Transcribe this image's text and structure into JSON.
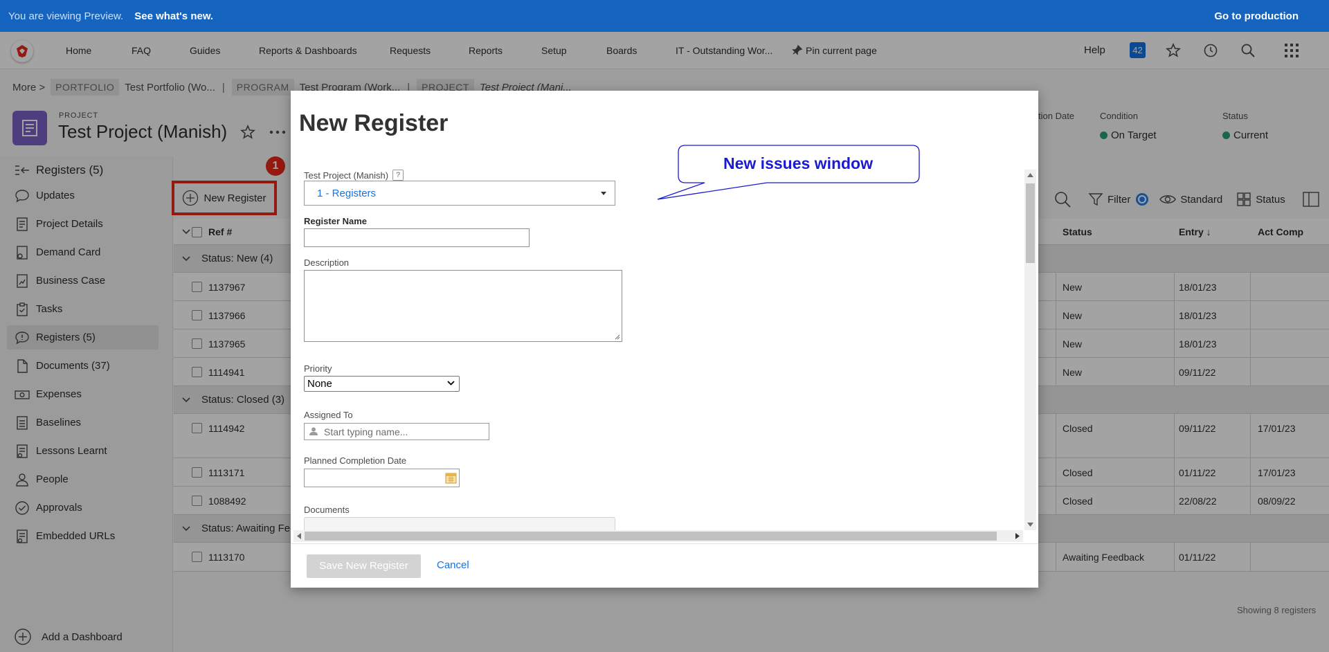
{
  "banner": {
    "text": "You are viewing Preview.",
    "link": "See what's new.",
    "production": "Go to production"
  },
  "nav": {
    "items": [
      "Home",
      "FAQ",
      "Guides",
      "Reports & Dashboards",
      "Requests",
      "Reports",
      "Setup",
      "Boards",
      "IT - Outstanding Wor...",
      "Pin current page"
    ],
    "help": "Help",
    "badge": "42"
  },
  "breadcrumb": {
    "more": "More >",
    "portfolio_tag": "PORTFOLIO",
    "portfolio": "Test Portfolio (Wo...",
    "program_tag": "PROGRAM",
    "program": "Test Program (Work...",
    "project_tag": "PROJECT",
    "project": "Test Project (Mani..."
  },
  "project": {
    "type": "PROJECT",
    "title": "Test Project (Manish)",
    "date_label": "tion Date",
    "condition_label": "Condition",
    "condition": "On Target",
    "status_label": "Status",
    "status": "Current",
    "status_color": "#2d9d78"
  },
  "sidebar": {
    "header": "Registers (5)",
    "items": [
      {
        "label": "Updates",
        "icon": "speech-bubble-icon"
      },
      {
        "label": "Project Details",
        "icon": "document-icon"
      },
      {
        "label": "Demand Card",
        "icon": "demand-card-icon"
      },
      {
        "label": "Business Case",
        "icon": "business-case-icon"
      },
      {
        "label": "Tasks",
        "icon": "clipboard-icon"
      },
      {
        "label": "Registers (5)",
        "icon": "alert-bubble-icon"
      },
      {
        "label": "Documents (37)",
        "icon": "file-icon"
      },
      {
        "label": "Expenses",
        "icon": "money-icon"
      },
      {
        "label": "Baselines",
        "icon": "baseline-icon"
      },
      {
        "label": "Lessons Learnt",
        "icon": "lessons-icon"
      },
      {
        "label": "People",
        "icon": "person-icon"
      },
      {
        "label": "Approvals",
        "icon": "check-circle-icon"
      },
      {
        "label": "Embedded URLs",
        "icon": "link-doc-icon"
      }
    ],
    "add_dashboard": "Add a Dashboard"
  },
  "toolbar": {
    "new_register": "New Register",
    "step_number": "1",
    "filter": "Filter",
    "standard": "Standard",
    "status": "Status"
  },
  "table": {
    "headers": {
      "ref": "Ref #",
      "status": "Status",
      "entry": "Entry ↓",
      "act_comp": "Act Comp"
    },
    "groups": [
      {
        "label": "Status: New (4)",
        "rows": [
          {
            "ref": "1137967",
            "status": "New",
            "entry": "18/01/23",
            "act": ""
          },
          {
            "ref": "1137966",
            "status": "New",
            "entry": "18/01/23",
            "act": ""
          },
          {
            "ref": "1137965",
            "status": "New",
            "entry": "18/01/23",
            "act": ""
          },
          {
            "ref": "1114941",
            "status": "New",
            "entry": "09/11/22",
            "act": ""
          }
        ]
      },
      {
        "label": "Status: Closed (3)",
        "rows": [
          {
            "ref": "1114942",
            "status": "Closed",
            "entry": "09/11/22",
            "act": "17/01/23"
          },
          {
            "ref": "1113171",
            "status": "Closed",
            "entry": "01/11/22",
            "act": "17/01/23"
          },
          {
            "ref": "1088492",
            "status": "Closed",
            "entry": "22/08/22",
            "act": "08/09/22"
          }
        ]
      },
      {
        "label": "Status: Awaiting Fe",
        "rows": [
          {
            "ref": "1113170",
            "status": "Awaiting Feedback",
            "entry": "01/11/22",
            "act": ""
          }
        ]
      }
    ],
    "showing": "Showing 8 registers"
  },
  "modal": {
    "title": "New Register",
    "project_label": "Test Project (Manish)",
    "project_help": "?",
    "register_select": "1 - Registers",
    "name_label": "Register Name",
    "name_value": "",
    "description_label": "Description",
    "priority_label": "Priority",
    "priority_value": "None",
    "assigned_label": "Assigned To",
    "assigned_placeholder": "Start typing name...",
    "planned_label": "Planned Completion Date",
    "documents_label": "Documents",
    "save": "Save New Register",
    "cancel": "Cancel"
  },
  "callout": {
    "text": "New issues window"
  }
}
